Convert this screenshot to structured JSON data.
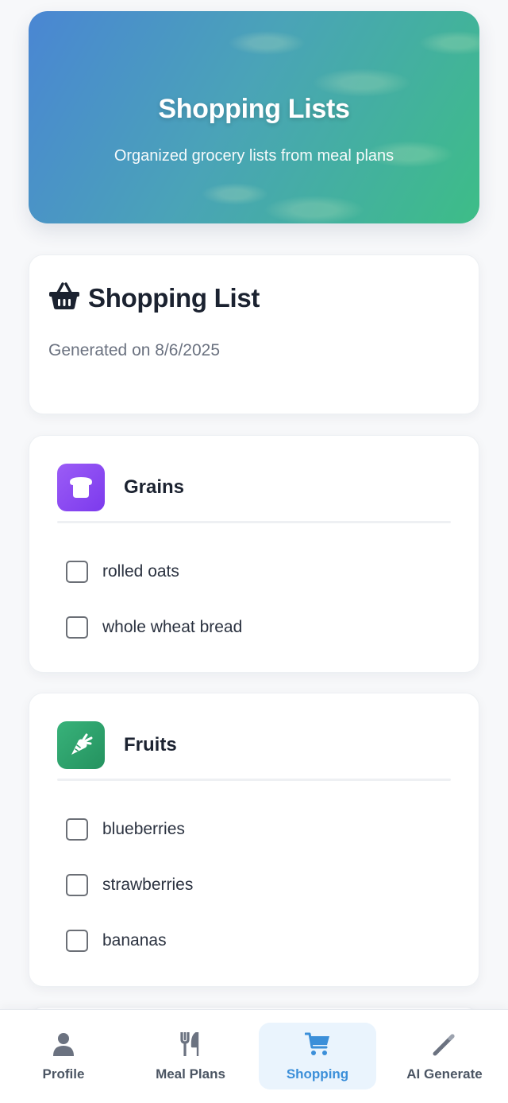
{
  "hero": {
    "title": "Shopping Lists",
    "subtitle": "Organized grocery lists from meal plans"
  },
  "list": {
    "title": "Shopping List",
    "icon": "basket-icon",
    "generated": "Generated on 8/6/2025"
  },
  "categories": [
    {
      "name": "Grains",
      "icon": "bread-icon",
      "color": "#8b4cf0",
      "items": [
        {
          "label": "rolled oats",
          "checked": false
        },
        {
          "label": "whole wheat bread",
          "checked": false
        }
      ]
    },
    {
      "name": "Fruits",
      "icon": "carrot-icon",
      "color": "#2fa06e",
      "items": [
        {
          "label": "blueberries",
          "checked": false
        },
        {
          "label": "strawberries",
          "checked": false
        },
        {
          "label": "bananas",
          "checked": false
        }
      ]
    }
  ],
  "nav": {
    "items": [
      {
        "label": "Profile",
        "icon": "person-icon",
        "active": false
      },
      {
        "label": "Meal Plans",
        "icon": "utensils-icon",
        "active": false
      },
      {
        "label": "Shopping",
        "icon": "cart-icon",
        "active": true
      },
      {
        "label": "AI Generate",
        "icon": "wand-icon",
        "active": false
      }
    ]
  },
  "colors": {
    "accent": "#3b8fd9",
    "hero_start": "#4a86d3",
    "hero_end": "#3dbd87"
  }
}
